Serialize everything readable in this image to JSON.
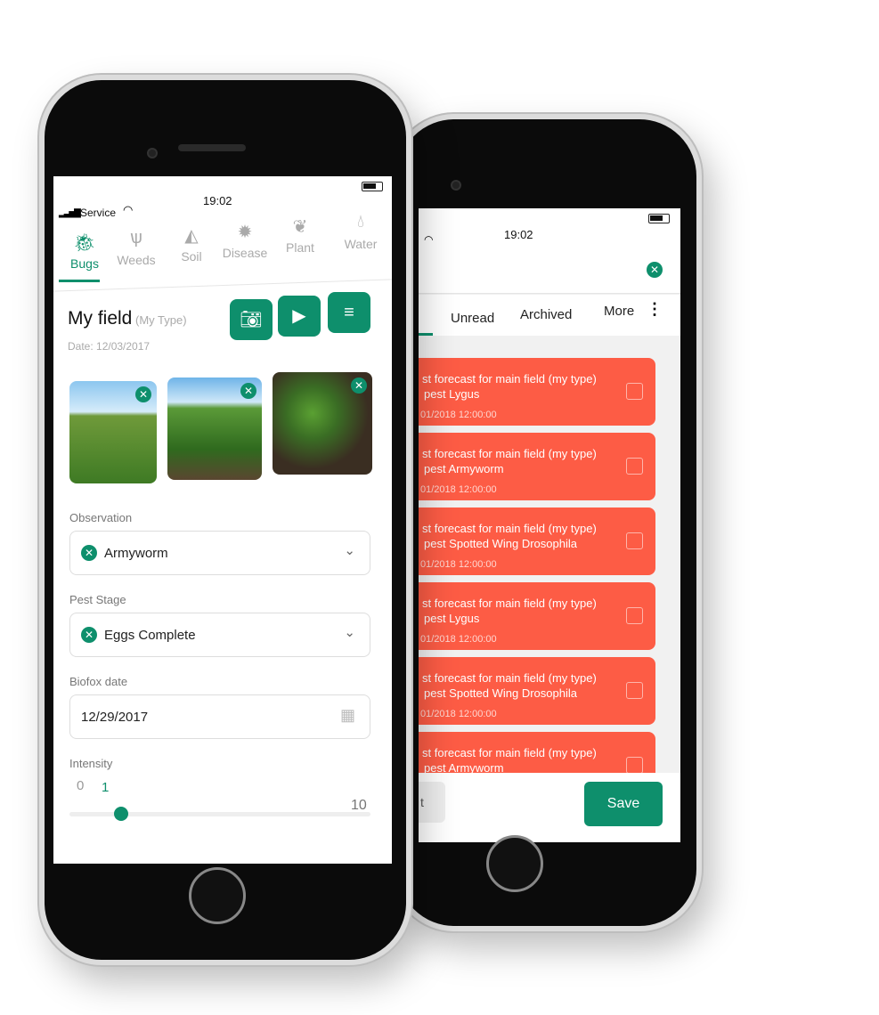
{
  "colors": {
    "accent": "#0e8f6c",
    "alert": "#fd5c45"
  },
  "back_phone": {
    "status": {
      "time": "19:02"
    },
    "close_icon": "close-icon",
    "tabs": [
      {
        "label": "Unread"
      },
      {
        "label": "Archived"
      },
      {
        "label": "More"
      }
    ],
    "cards": [
      {
        "line1": "st forecast for main field (my type)",
        "line2": "pest Lygus",
        "date": "01/2018 12:00:00"
      },
      {
        "line1": "st forecast for main field (my type)",
        "line2": "pest Armyworm",
        "date": "01/2018 12:00:00"
      },
      {
        "line1": "st forecast for main field (my type)",
        "line2": "pest Spotted Wing Drosophila",
        "date": "01/2018 12:00:00"
      },
      {
        "line1": "st forecast for main field (my type)",
        "line2": "pest Lygus",
        "date": "01/2018 12:00:00"
      },
      {
        "line1": "st forecast for main field (my type)",
        "line2": "pest Spotted Wing Drosophila",
        "date": "01/2018 12:00:00"
      },
      {
        "line1": "st forecast for main field (my type)",
        "line2": "pest Armyworm",
        "date": ""
      }
    ],
    "footer": {
      "left_label": "t",
      "save_label": "Save"
    }
  },
  "front_phone": {
    "status": {
      "carrier": "Service",
      "time": "19:02"
    },
    "tabs": [
      {
        "label": "Bugs",
        "icon": "bug-icon"
      },
      {
        "label": "Weeds",
        "icon": "grass-icon"
      },
      {
        "label": "Soil",
        "icon": "soil-icon"
      },
      {
        "label": "Disease",
        "icon": "virus-icon"
      },
      {
        "label": "Plant",
        "icon": "leaf-icon"
      },
      {
        "label": "Water",
        "icon": "droplets-icon"
      }
    ],
    "title": "My field",
    "subtitle": "(My Type)",
    "date": "Date: 12/03/2017",
    "observation": {
      "label": "Observation",
      "value": "Armyworm"
    },
    "pest_stage": {
      "label": "Pest Stage",
      "value": "Eggs Complete"
    },
    "biofox_date": {
      "label": "Biofox date",
      "value": "12/29/2017"
    },
    "intensity": {
      "label": "Intensity",
      "min": "0",
      "max": "10",
      "value": "1"
    }
  }
}
